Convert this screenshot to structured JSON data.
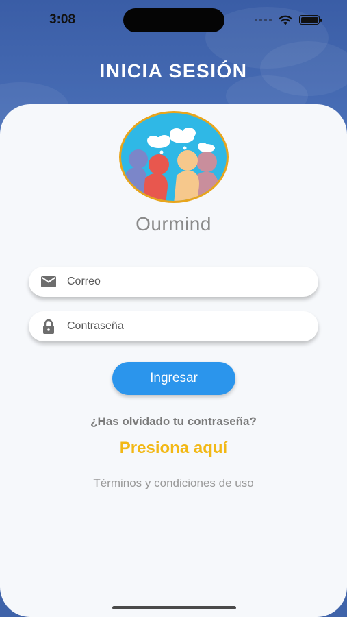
{
  "status_bar": {
    "time": "3:08"
  },
  "header": {
    "title": "INICIA SESIÓN"
  },
  "brand": {
    "name": "Ourmind"
  },
  "form": {
    "email_placeholder": "Correo",
    "email_value": "",
    "email_icon": "mail-icon",
    "password_placeholder": "Contraseña",
    "password_value": "",
    "password_icon": "lock-icon"
  },
  "actions": {
    "submit_label": "Ingresar",
    "forgot_text": "¿Has olvidado tu contraseña?",
    "press_here_label": "Presiona aquí",
    "terms_label": "Términos y condiciones de uso"
  },
  "colors": {
    "header_blue": "#3f63a9",
    "button_blue": "#2b95ec",
    "link_yellow": "#f2b815",
    "card_bg": "#f6f8fb"
  }
}
